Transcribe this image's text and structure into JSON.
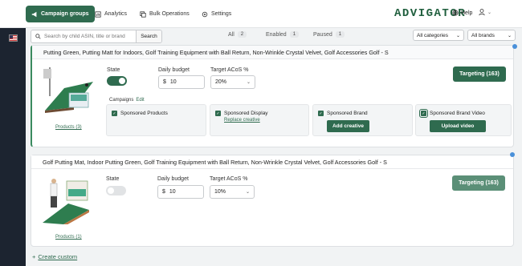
{
  "nav": {
    "tabs": [
      {
        "label": "Campaign groups"
      },
      {
        "label": "Analytics"
      },
      {
        "label": "Bulk Operations"
      },
      {
        "label": "Settings"
      }
    ],
    "logo": "ADVIGATOR",
    "help": "Help"
  },
  "filters": {
    "search_placeholder": "Search by child ASIN, title or brand",
    "search_button": "Search",
    "segments": [
      {
        "label": "All",
        "count": "2"
      },
      {
        "label": "Enabled",
        "count": "1"
      },
      {
        "label": "Paused",
        "count": "1"
      }
    ],
    "categories": "All categories",
    "brands": "All brands"
  },
  "cards": [
    {
      "title": "Putting Green, Putting Matt for Indoors, Golf Training Equipment with Ball Return, Non-Wrinkle Crystal Velvet, Golf Accessories Golf - S",
      "products_link": "Products (3)",
      "state_label": "State",
      "state_on": true,
      "budget_label": "Daily budget",
      "budget_currency": "$",
      "budget_value": "10",
      "acos_label": "Target ACoS %",
      "acos_value": "20%",
      "targeting": "Targeting (163)",
      "campaigns_label": "Campaigns",
      "campaigns_edit": "Edit",
      "campaigns": [
        {
          "name": "Sponsored Products"
        },
        {
          "name": "Sponsored Display",
          "link": "Replace creative"
        },
        {
          "name": "Sponsored Brand",
          "button": "Add creative"
        },
        {
          "name": "Sponsored Brand Video",
          "button": "Upload video"
        }
      ]
    },
    {
      "title": "Golf Putting Mat, Indoor Putting Green, Golf Training Equipment with Ball Return, Non-Wrinkle Crystal Velvet, Golf Accessories Golf - S",
      "products_link": "Products (1)",
      "state_label": "State",
      "state_on": false,
      "budget_label": "Daily budget",
      "budget_currency": "$",
      "budget_value": "10",
      "acos_label": "Target ACoS %",
      "acos_value": "10%",
      "targeting": "Targeting (163)"
    }
  ],
  "create_custom": "Create custom",
  "colors": {
    "accent": "#2f6b4f",
    "sidebar": "#1c2430",
    "dot": "#4a90d9"
  }
}
